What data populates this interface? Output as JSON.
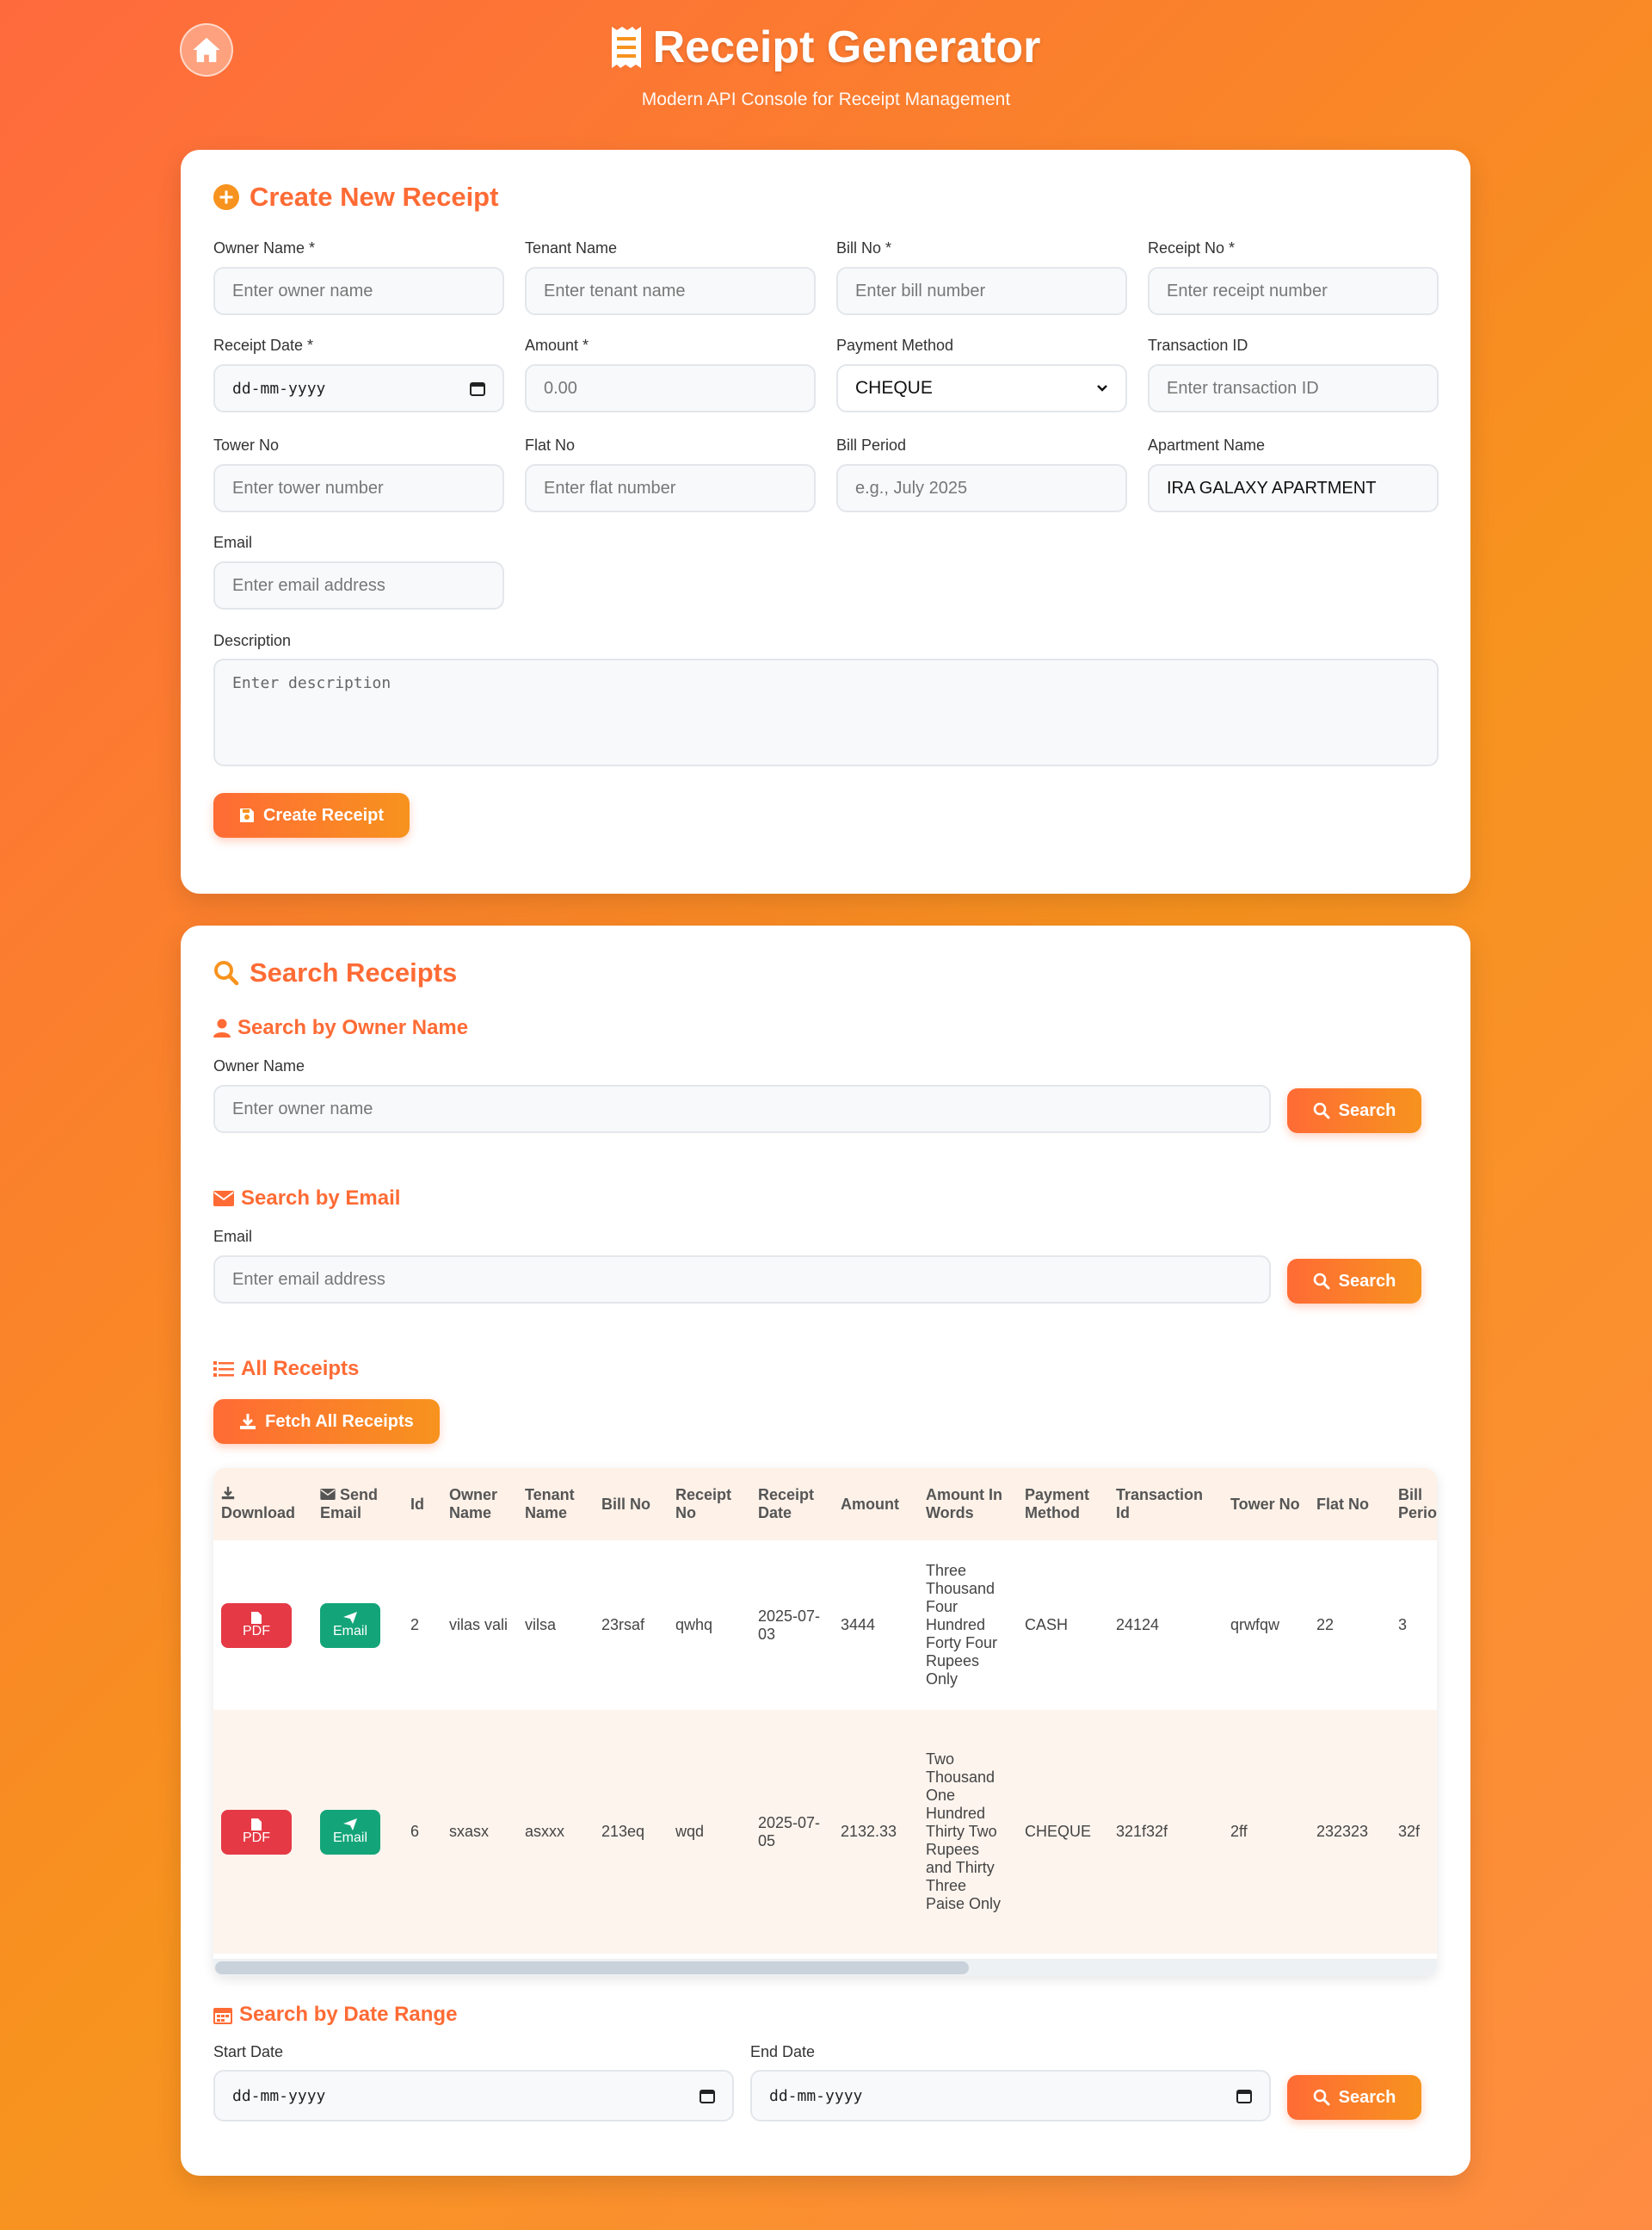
{
  "header": {
    "title": "Receipt Generator",
    "subtitle": "Modern API Console for Receipt Management"
  },
  "create": {
    "title": "Create New Receipt",
    "fields": {
      "owner_name": {
        "label": "Owner Name *",
        "placeholder": "Enter owner name"
      },
      "tenant_name": {
        "label": "Tenant Name",
        "placeholder": "Enter tenant name"
      },
      "bill_no": {
        "label": "Bill No *",
        "placeholder": "Enter bill number"
      },
      "receipt_no": {
        "label": "Receipt No *",
        "placeholder": "Enter receipt number"
      },
      "receipt_date": {
        "label": "Receipt Date *",
        "placeholder": "dd-mm-yyyy"
      },
      "amount": {
        "label": "Amount *",
        "placeholder": "0.00"
      },
      "payment_method": {
        "label": "Payment Method",
        "value": "CHEQUE"
      },
      "transaction_id": {
        "label": "Transaction ID",
        "placeholder": "Enter transaction ID"
      },
      "tower_no": {
        "label": "Tower No",
        "placeholder": "Enter tower number"
      },
      "flat_no": {
        "label": "Flat No",
        "placeholder": "Enter flat number"
      },
      "bill_period": {
        "label": "Bill Period",
        "placeholder": "e.g., July 2025"
      },
      "apartment_name": {
        "label": "Apartment Name",
        "value": "IRA GALAXY APARTMENT"
      },
      "email": {
        "label": "Email",
        "placeholder": "Enter email address"
      },
      "description": {
        "label": "Description",
        "placeholder": "Enter description"
      }
    },
    "submit_label": "Create Receipt"
  },
  "search": {
    "title": "Search Receipts",
    "by_owner": {
      "title": "Search by Owner Name",
      "label": "Owner Name",
      "placeholder": "Enter owner name",
      "button": "Search"
    },
    "by_email": {
      "title": "Search by Email",
      "label": "Email",
      "placeholder": "Enter email address",
      "button": "Search"
    },
    "all": {
      "title": "All Receipts",
      "button": "Fetch All Receipts"
    },
    "by_date": {
      "title": "Search by Date Range",
      "start_label": "Start Date",
      "start_placeholder": "dd-mm-yyyy",
      "end_label": "End Date",
      "end_placeholder": "dd-mm-yyyy",
      "button": "Search"
    }
  },
  "table": {
    "headers": {
      "download": "Download",
      "send_email": "Send Email",
      "id": "Id",
      "owner_name": "Owner Name",
      "tenant_name": "Tenant Name",
      "bill_no": "Bill No",
      "receipt_no": "Receipt No",
      "receipt_date": "Receipt Date",
      "amount": "Amount",
      "amount_words": "Amount In Words",
      "payment_method": "Payment Method",
      "transaction_id": "Transaction Id",
      "tower_no": "Tower No",
      "flat_no": "Flat No",
      "bill_period": "Bill Period"
    },
    "pdf_label": "PDF",
    "email_label": "Email",
    "rows": [
      {
        "id": "2",
        "owner_name": "vilas vali",
        "tenant_name": "vilsa",
        "bill_no": "23rsaf",
        "receipt_no": "qwhq",
        "receipt_date": "2025-07-03",
        "amount": "3444",
        "amount_words": "Three Thousand Four Hundred Forty Four Rupees Only",
        "payment_method": "CASH",
        "transaction_id": "24124",
        "tower_no": "qrwfqw",
        "flat_no": "22",
        "bill_period": "3"
      },
      {
        "id": "6",
        "owner_name": "sxasx",
        "tenant_name": "asxxx",
        "bill_no": "213eq",
        "receipt_no": "wqd",
        "receipt_date": "2025-07-05",
        "amount": "2132.33",
        "amount_words": "Two Thousand One Hundred Thirty Two Rupees and Thirty Three Paise Only",
        "payment_method": "CHEQUE",
        "transaction_id": "321f32f",
        "tower_no": "2ff",
        "flat_no": "232323",
        "bill_period": "32f"
      }
    ]
  },
  "colors": {
    "accent": "#ff6b35",
    "pdf": "#e53945",
    "email": "#13a579"
  }
}
